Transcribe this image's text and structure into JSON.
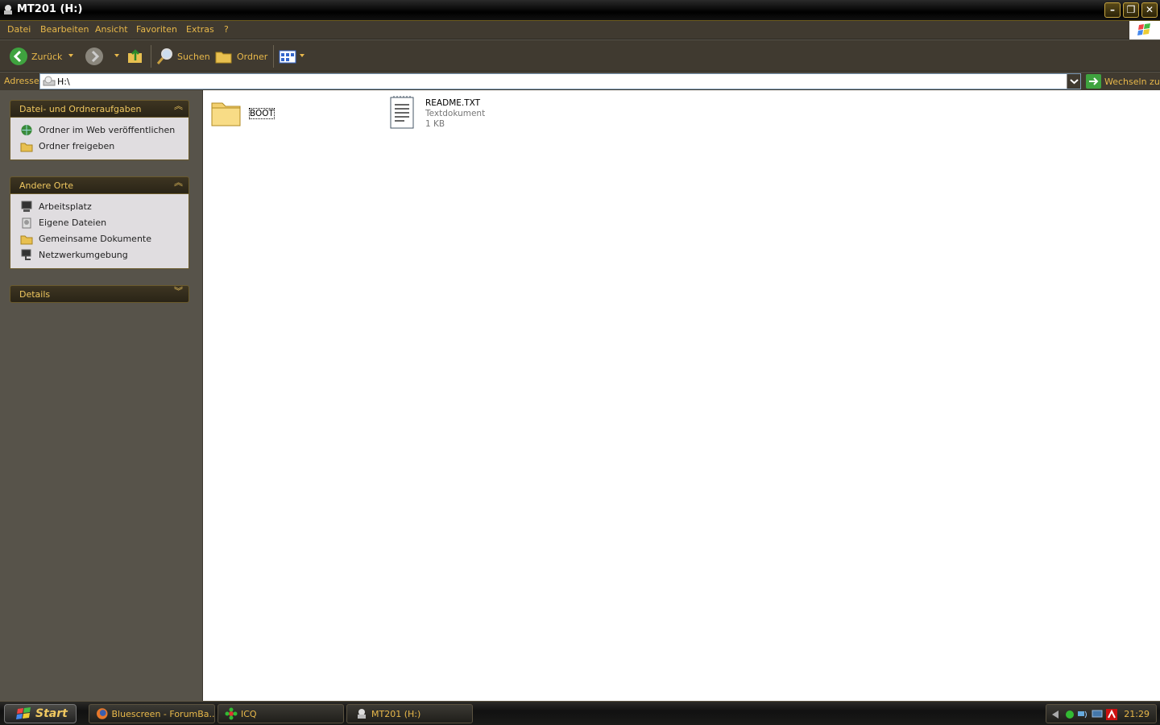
{
  "window": {
    "title": "MT201 (H:)",
    "minimize": "–",
    "maximize": "❐",
    "close": "✕"
  },
  "menubar": {
    "items": [
      "Datei",
      "Bearbeiten",
      "Ansicht",
      "Favoriten",
      "Extras",
      "?"
    ]
  },
  "toolbar": {
    "back_label": "Zurück",
    "search_label": "Suchen",
    "folders_label": "Ordner"
  },
  "address": {
    "label": "Adresse",
    "value": "H:\\",
    "go_label": "Wechseln zu"
  },
  "taskpane": {
    "tasks": {
      "title": "Datei- und Ordneraufgaben",
      "items": [
        "Ordner im Web veröffentlichen",
        "Ordner freigeben"
      ]
    },
    "other_places": {
      "title": "Andere Orte",
      "items": [
        "Arbeitsplatz",
        "Eigene Dateien",
        "Gemeinsame Dokumente",
        "Netzwerkumgebung"
      ]
    },
    "details": {
      "title": "Details"
    }
  },
  "files": [
    {
      "name": "BOOT",
      "type": "folder"
    },
    {
      "name": "README.TXT",
      "type": "Textdokument",
      "size": "1 KB"
    }
  ],
  "taskbar": {
    "start_label": "Start",
    "tasks": [
      "Bluescreen - ForumBa...",
      "ICQ",
      "MT201 (H:)"
    ],
    "clock": "21:29"
  },
  "colors": {
    "accent": "#e8b84a",
    "chrome": "#403a30",
    "pane_bg": "#57534a"
  }
}
